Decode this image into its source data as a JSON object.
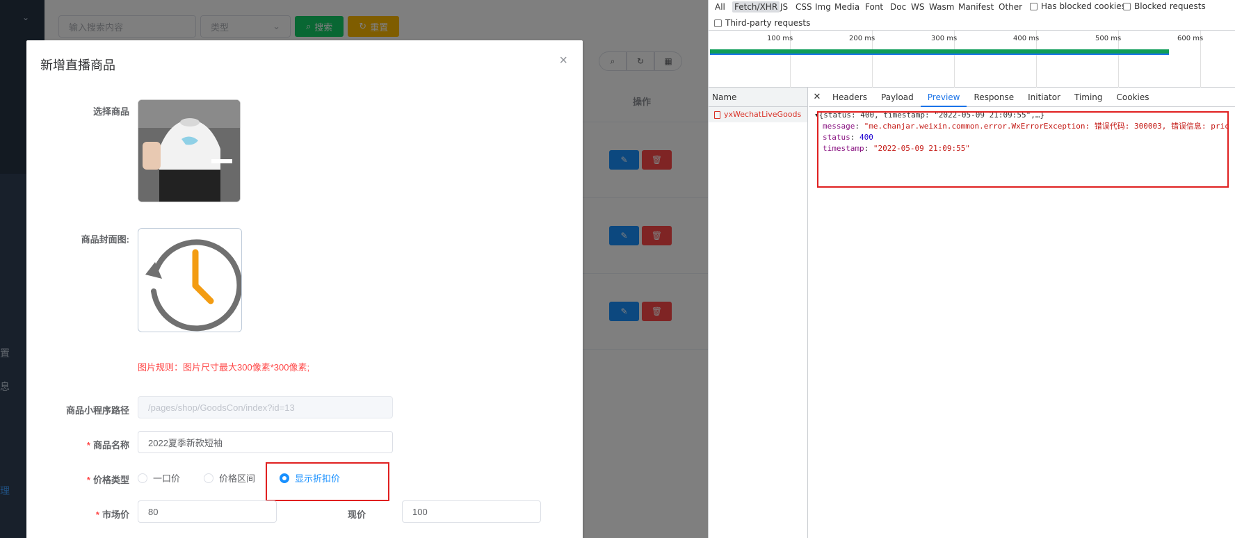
{
  "app": {
    "sidebar_fragments": [
      {
        "text": "置",
        "top": 0
      },
      {
        "text": "息",
        "top": 0
      },
      {
        "text": "理",
        "top": 0
      }
    ],
    "search": {
      "placeholder": "输入搜索内容",
      "type_placeholder": "类型",
      "search_label": "搜索",
      "reset_label": "重置"
    },
    "table": {
      "op_header": "操作"
    }
  },
  "dialog": {
    "title": "新增直播商品",
    "labels": {
      "select_goods": "选择商品",
      "cover": "商品封面图:",
      "path": "商品小程序路径",
      "name": "商品名称",
      "price_type": "价格类型",
      "market_price": "市场价",
      "current_price": "现价"
    },
    "image_rule": "图片规则：图片尺寸最大300像素*300像素;",
    "path_value": "/pages/shop/GoodsCon/index?id=13",
    "name_value": "2022夏季新款短袖",
    "price_type_options": [
      "一口价",
      "价格区间",
      "显示折扣价"
    ],
    "price_type_selected": "显示折扣价",
    "market_price_value": "80",
    "current_price_value": "100"
  },
  "devtools": {
    "filters": [
      "All",
      "Fetch/XHR",
      "JS",
      "CSS",
      "Img",
      "Media",
      "Font",
      "Doc",
      "WS",
      "Wasm",
      "Manifest",
      "Other"
    ],
    "active_filter": "Fetch/XHR",
    "checkboxes": [
      "Has blocked cookies",
      "Blocked requests",
      "Third-party requests"
    ],
    "ticks": [
      "100 ms",
      "200 ms",
      "300 ms",
      "400 ms",
      "500 ms",
      "600 ms"
    ],
    "name_header": "Name",
    "request_name": "yxWechatLiveGoods",
    "tabs": [
      "Headers",
      "Payload",
      "Preview",
      "Response",
      "Initiator",
      "Timing",
      "Cookies"
    ],
    "active_tab": "Preview",
    "preview": {
      "summary": "{status: 400, timestamp: \"2022-05-09 21:09:55\",…}",
      "message_key": "message",
      "message_value": "\"me.chanjar.weixin.common.error.WxErrorException: 错误代码: 300003, 错误信息: pric",
      "status_key": "status",
      "status_value": "400",
      "timestamp_key": "timestamp",
      "timestamp_value": "\"2022-05-09 21:09:55\""
    }
  }
}
